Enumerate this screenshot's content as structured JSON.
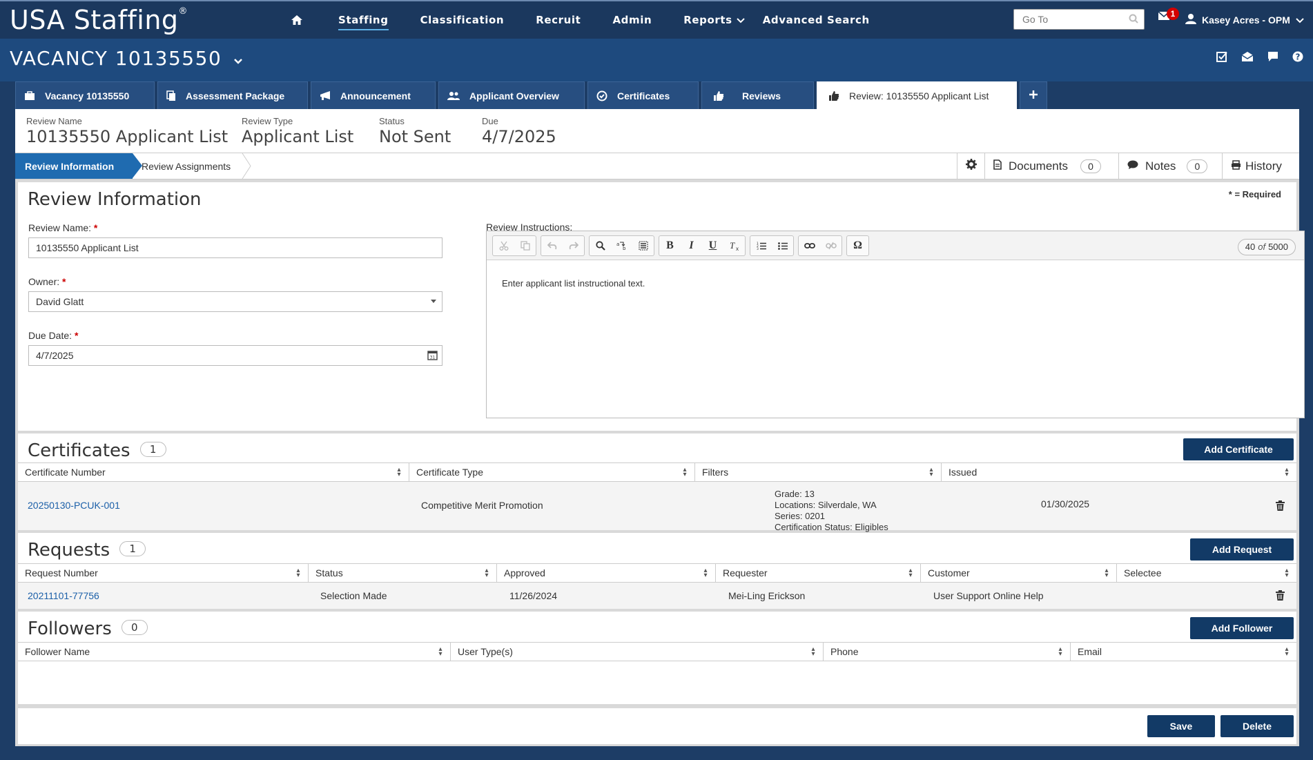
{
  "brand": {
    "name": "USA Staffing",
    "mark": "®"
  },
  "topnav": {
    "items": [
      {
        "label": "Staffing",
        "active": true
      },
      {
        "label": "Classification"
      },
      {
        "label": "Recruit"
      },
      {
        "label": "Admin"
      },
      {
        "label": "Reports",
        "has_dropdown": true
      },
      {
        "label": "Advanced Search"
      }
    ],
    "goto_placeholder": "Go To",
    "mail_count": "1",
    "user_name": "Kasey Acres - OPM"
  },
  "vacancy": {
    "title": "VACANCY 10135550"
  },
  "tabs": [
    {
      "label": "Vacancy 10135550",
      "icon": "briefcase-icon"
    },
    {
      "label": "Assessment Package",
      "icon": "documents-icon"
    },
    {
      "label": "Announcement",
      "icon": "megaphone-icon"
    },
    {
      "label": "Applicant Overview",
      "icon": "users-icon"
    },
    {
      "label": "Certificates",
      "icon": "check-circle-icon"
    },
    {
      "label": "Reviews",
      "icon": "thumbs-up-icon"
    },
    {
      "label": "Review: 10135550 Applicant List",
      "icon": "thumbs-up-icon",
      "active": true
    }
  ],
  "summary": {
    "review_name_label": "Review Name",
    "review_name": "10135550 Applicant List",
    "review_type_label": "Review Type",
    "review_type": "Applicant List",
    "status_label": "Status",
    "status": "Not Sent",
    "due_label": "Due",
    "due": "4/7/2025"
  },
  "subnav": {
    "active": "Review Information",
    "item": "Review Assignments",
    "documents_label": "Documents",
    "documents_count": "0",
    "notes_label": "Notes",
    "notes_count": "0",
    "history_label": "History"
  },
  "review_info": {
    "title": "Review Information",
    "required_note": "* = Required",
    "name_label": "Review Name:",
    "name_value": "10135550 Applicant List",
    "owner_label": "Owner:",
    "owner_value": "David Glatt",
    "due_label": "Due Date:",
    "due_value": "4/7/2025",
    "instructions_label": "Review Instructions:",
    "char_count": "40",
    "char_of": "of",
    "char_max": "5000",
    "instructions_text": "Enter applicant list instructional text.",
    "required_star": "*"
  },
  "certificates": {
    "title": "Certificates",
    "count": "1",
    "add_label": "Add Certificate",
    "columns": [
      "Certificate Number",
      "Certificate Type",
      "Filters",
      "Issued"
    ],
    "rows": [
      {
        "number": "20250130-PCUK-001",
        "type": "Competitive Merit Promotion",
        "filters": [
          "Grade: 13",
          "Locations: Silverdale, WA",
          "Series: 0201",
          "Certification Status: Eligibles"
        ],
        "issued": "01/30/2025"
      }
    ]
  },
  "requests": {
    "title": "Requests",
    "count": "1",
    "add_label": "Add Request",
    "columns": [
      "Request Number",
      "Status",
      "Approved",
      "Requester",
      "Customer",
      "Selectee"
    ],
    "rows": [
      {
        "number": "20211101-77756",
        "status": "Selection Made",
        "approved": "11/26/2024",
        "requester": "Mei-Ling Erickson",
        "customer": "User Support Online Help",
        "selectee": ""
      }
    ]
  },
  "followers": {
    "title": "Followers",
    "count": "0",
    "add_label": "Add Follower",
    "columns": [
      "Follower Name",
      "User Type(s)",
      "Phone",
      "Email"
    ]
  },
  "footer": {
    "save_label": "Save",
    "delete_label": "Delete"
  }
}
